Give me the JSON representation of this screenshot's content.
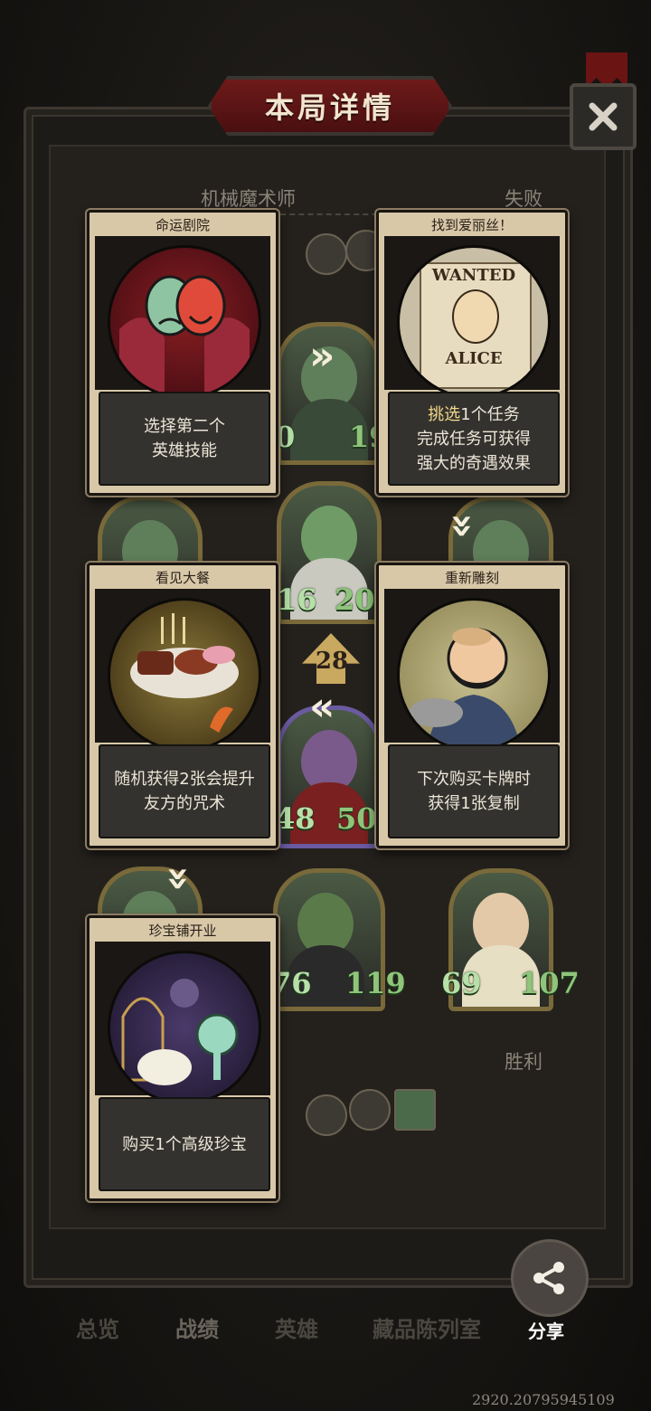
{
  "header": {
    "title": "本局详情"
  },
  "rows": [
    {
      "hero_name": "机械魔术师",
      "result": "失败"
    },
    {
      "hero_name": "",
      "result": "胜利"
    }
  ],
  "battle": {
    "arrow_count": "28",
    "stats": [
      {
        "atk": "0",
        "hp": "19"
      },
      {
        "atk": "16",
        "hp": "20"
      },
      {
        "atk": "48",
        "hp": "50"
      },
      {
        "atk": "76",
        "hp": "119"
      },
      {
        "atk": "69",
        "hp": "107"
      }
    ]
  },
  "cards": [
    {
      "title": "命运剧院",
      "lines": [
        "选择第二个",
        "英雄技能"
      ]
    },
    {
      "title": "找到爱丽丝！",
      "highlight": "挑选",
      "lines": [
        "1个任务",
        "完成任务可获得",
        "强大的奇遇效果"
      ],
      "art_text_top": "WANTED",
      "art_text_bottom": "ALICE"
    },
    {
      "title": "看见大餐",
      "lines": [
        "随机获得2张会提升",
        "友方的咒术"
      ]
    },
    {
      "title": "重新雕刻",
      "lines": [
        "下次购买卡牌时",
        "获得1张复制"
      ]
    },
    {
      "title": "珍宝铺开业",
      "lines": [
        "购买1个高级珍宝"
      ]
    }
  ],
  "tabs": [
    "总览",
    "战绩",
    "英雄",
    "藏品陈列室"
  ],
  "share": {
    "label": "分享"
  },
  "footer": {
    "uid": "2920.20795945109"
  },
  "colors": {
    "title_plate": "#6e1a1a",
    "card_paper": "#d8c8a8",
    "stat_green": "#8ec57a"
  }
}
